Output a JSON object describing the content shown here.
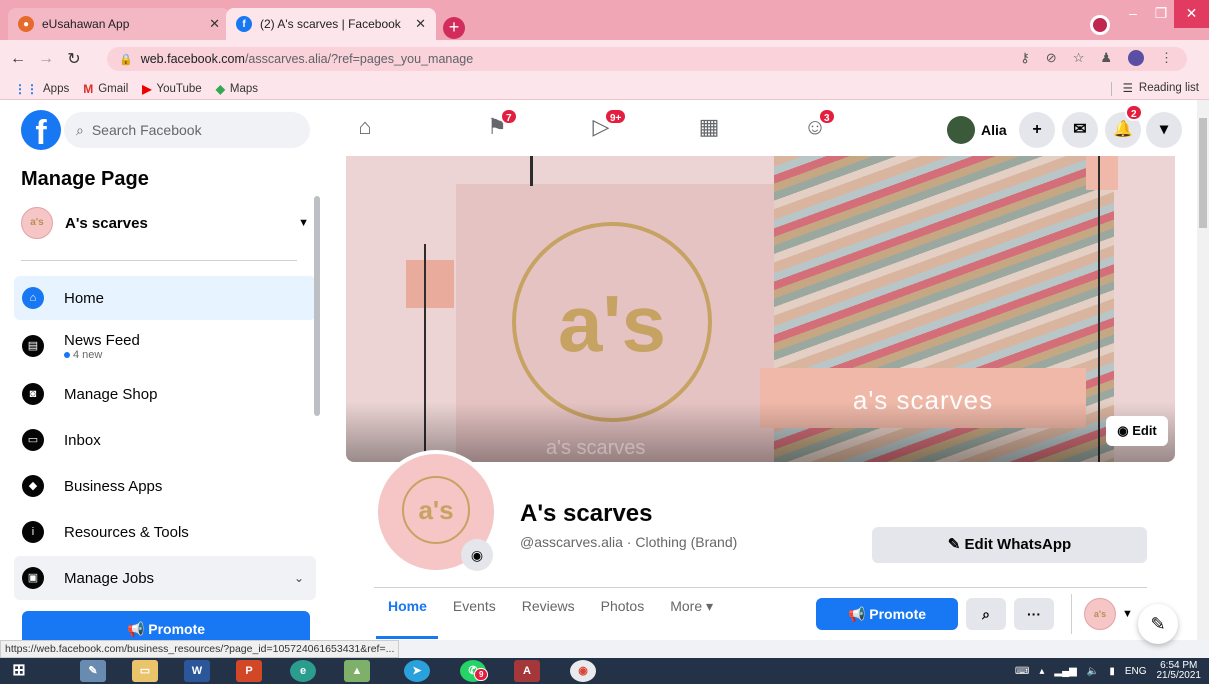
{
  "browser": {
    "tabs": [
      {
        "title": "eUsahawan App",
        "active": false
      },
      {
        "title": "(2) A's scarves | Facebook",
        "active": true
      }
    ],
    "url_host": "web.facebook.com",
    "url_path": "/asscarves.alia/?ref=pages_you_manage",
    "bookmarks": [
      "Apps",
      "Gmail",
      "YouTube",
      "Maps"
    ],
    "reading_list": "Reading list",
    "status_url": "https://web.facebook.com/business_resources/?page_id=105724061653431&ref=..."
  },
  "fb_nav": {
    "search_placeholder": "Search Facebook",
    "badges": {
      "pages": "7",
      "watch": "9+",
      "groups": "3",
      "notifications": "2"
    },
    "user_name": "Alia"
  },
  "sidebar": {
    "title": "Manage Page",
    "page_name": "A's scarves",
    "items": [
      {
        "label": "Home",
        "sub": ""
      },
      {
        "label": "News Feed",
        "sub": "4 new"
      },
      {
        "label": "Manage Shop",
        "sub": ""
      },
      {
        "label": "Inbox",
        "sub": ""
      },
      {
        "label": "Business Apps",
        "sub": ""
      },
      {
        "label": "Resources & Tools",
        "sub": ""
      },
      {
        "label": "Manage Jobs",
        "sub": ""
      }
    ],
    "promote_label": "Promote"
  },
  "page": {
    "cover_text": "a's scarves",
    "cover_logo": "a's",
    "edit_cover_label": "Edit",
    "name": "A's scarves",
    "handle": "@asscarves.alia · Clothing (Brand)",
    "whatsapp_label": "Edit WhatsApp",
    "tabs": [
      "Home",
      "Events",
      "Reviews",
      "Photos",
      "More"
    ],
    "promote_label": "Promote"
  },
  "taskbar": {
    "lang": "ENG",
    "time": "6:54 PM",
    "date": "21/5/2021",
    "telegram_badge": "9"
  },
  "colors": {
    "fb_blue": "#1877f2",
    "chrome_pink": "#f1a6b6",
    "brand_gold": "#c6a263",
    "brand_pink": "#f6c5c5"
  }
}
